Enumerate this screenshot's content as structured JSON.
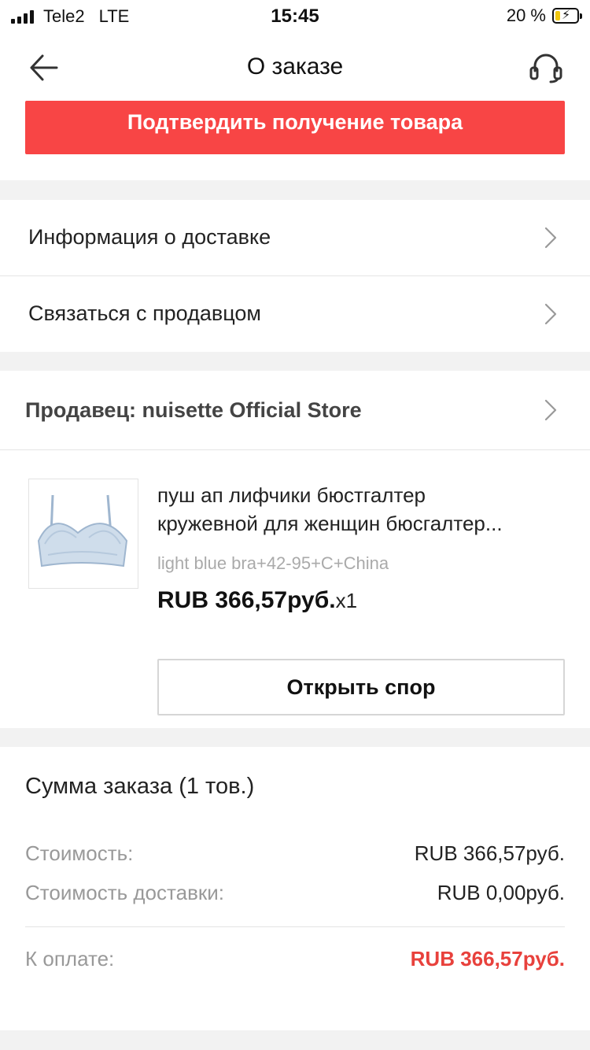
{
  "status_bar": {
    "carrier": "Tele2",
    "network": "LTE",
    "time": "15:45",
    "battery_percent": "20 %",
    "battery_level": 0.2,
    "battery_color": "#f2c80f"
  },
  "nav": {
    "back_icon": "arrow-left-icon",
    "title": "О заказе",
    "support_icon": "headset-icon"
  },
  "confirm_button": {
    "label": "Подтвердить получение товара",
    "color": "#f84545"
  },
  "menu": {
    "items": [
      {
        "label": "Информация о доставке"
      },
      {
        "label": "Связаться с продавцом"
      }
    ]
  },
  "order": {
    "seller_label": "Продавец: nuisette Official Store",
    "product": {
      "title_line1": "пуш ап лифчики бюстгалтер",
      "title_line2": "кружевной для женщин бюсгалтер...",
      "sku": "light blue bra+42-95+C+China",
      "price": "RUB 366,57руб.",
      "quantity": "x1",
      "image_icon": "bra-product-image"
    },
    "dispute_button": "Открыть спор"
  },
  "summary": {
    "title": "Сумма заказа (1 тов.)",
    "rows": [
      {
        "key": "Стоимость:",
        "value": "RUB 366,57руб."
      },
      {
        "key": "Стоимость доставки:",
        "value": "RUB 0,00руб."
      }
    ],
    "total": {
      "key": "К оплате:",
      "value": "RUB 366,57руб.",
      "color": "#e8413c"
    }
  }
}
